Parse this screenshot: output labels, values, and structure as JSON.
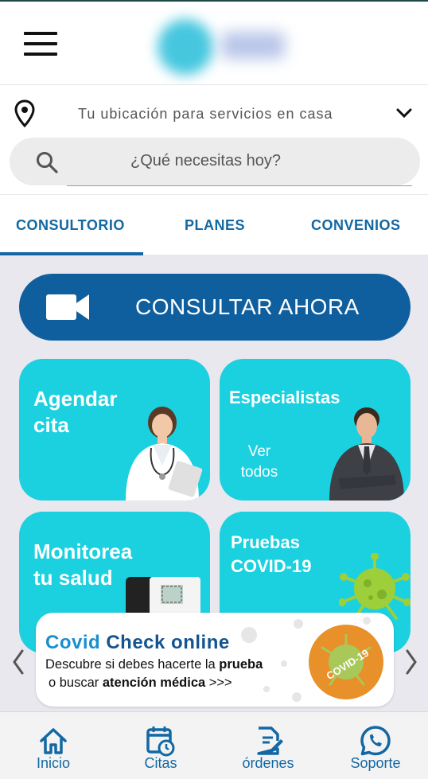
{
  "header": {
    "logo": "blurred-logo"
  },
  "location": {
    "text": "Tu ubicación para servicios en casa"
  },
  "search": {
    "placeholder": "¿Qué necesitas hoy?"
  },
  "tabs": [
    {
      "label": "CONSULTORIO",
      "active": true
    },
    {
      "label": "PLANES",
      "active": false
    },
    {
      "label": "CONVENIOS",
      "active": false
    }
  ],
  "cta": {
    "label": "CONSULTAR AHORA"
  },
  "cards": {
    "agendar": {
      "line1": "Agendar",
      "line2": "cita"
    },
    "especialistas": {
      "title": "Especialistas",
      "sub1": "Ver",
      "sub2": "todos"
    },
    "monitorea": {
      "line1": "Monitorea",
      "line2": "tu salud"
    },
    "pruebas": {
      "line1": "Pruebas",
      "line2": "COVID-19"
    }
  },
  "banner": {
    "title1": "Covid",
    "title2": "Check online",
    "line1_prefix": "Descubre si debes hacerte la ",
    "line1_bold": "prueba",
    "line2_prefix": "o buscar ",
    "line2_bold": "atención médica",
    "line2_suffix": " >>>",
    "badge_text": "COVID-19"
  },
  "nav": [
    {
      "label": "Inicio",
      "icon": "home-icon"
    },
    {
      "label": "Citas",
      "icon": "calendar-clock-icon"
    },
    {
      "label": "órdenes",
      "icon": "document-edit-icon"
    },
    {
      "label": "Soporte",
      "icon": "whatsapp-icon"
    }
  ],
  "colors": {
    "primary": "#1367a3",
    "cta": "#0f5f9e",
    "card": "#1bd0df",
    "banner_title": "#1a8fd0",
    "covid_orange": "#e8902a",
    "virus_green": "#9ccf3a"
  }
}
